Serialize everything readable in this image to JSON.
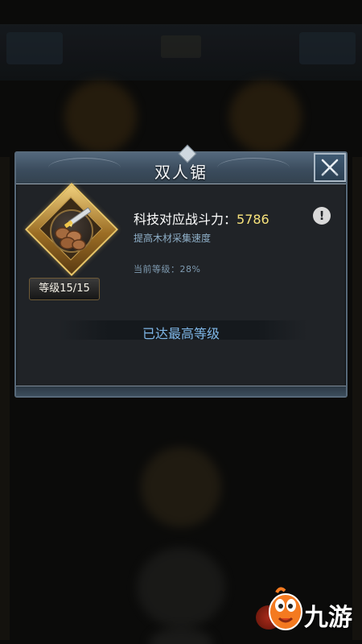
{
  "dialog": {
    "title": "双人锯",
    "close_icon": "close-icon"
  },
  "tech": {
    "icon": "saw-logs-icon",
    "level_label": "等级15/15",
    "combat_label": "科技对应战斗力：",
    "combat_value": "5786",
    "description": "提高木材采集速度",
    "current_level": "当前等级：28%",
    "max_level_text": "已达最高等级",
    "info_icon": "exclamation-icon"
  },
  "watermark": {
    "text": "九游",
    "logo": "jiuyou-mascot-logo"
  },
  "colors": {
    "combat_value": "#f7e27b",
    "max_level_text": "#7fb7e8",
    "description": "#8fb0c9",
    "header": "#3b4c5d"
  }
}
